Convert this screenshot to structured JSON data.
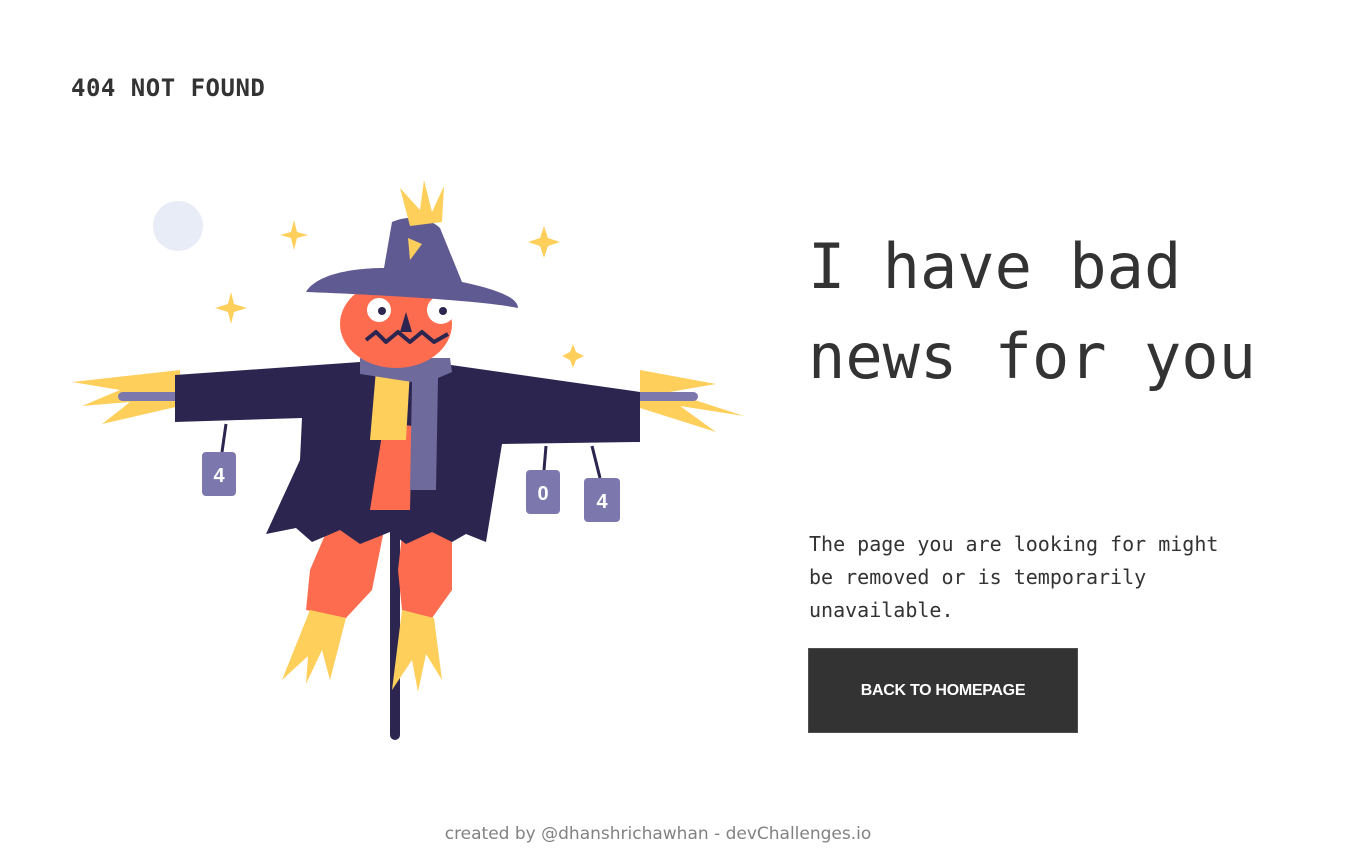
{
  "brand": {
    "title": "404 NOT FOUND"
  },
  "main": {
    "headline": "I have bad news for you",
    "message": "The page you are looking for might be removed or is temporarily unavailable.",
    "cta_label": "BACK TO HOMEPAGE"
  },
  "illustration": {
    "icon": "scarecrow-illustration",
    "can_left": "4",
    "can_middle": "0",
    "can_right": "4"
  },
  "footer": {
    "credit": "created by @dhanshrichawhan - devChallenges.io"
  },
  "colors": {
    "text": "#333333",
    "button_bg": "#333333",
    "button_text": "#ffffff",
    "footer_text": "#828282",
    "hat": "#5f5a91",
    "coat": "#2b2550",
    "face": "#fe6c4f",
    "straw": "#ffcf5c",
    "scarf": "#6e6a9c",
    "moon": "#e7ecf6"
  }
}
